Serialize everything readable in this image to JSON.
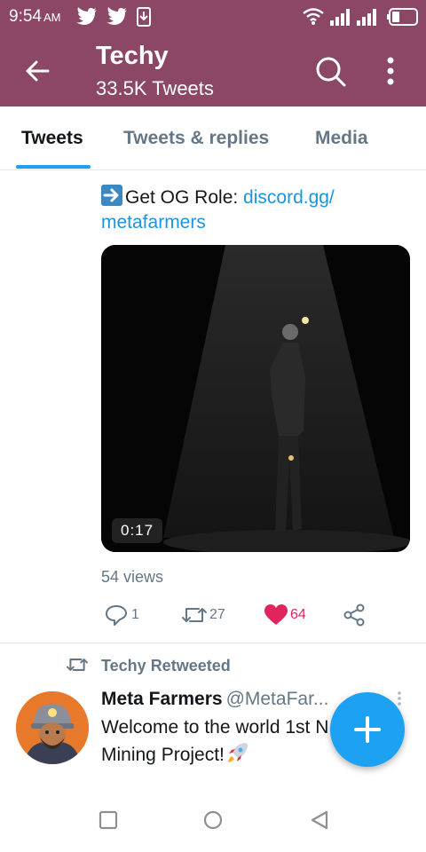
{
  "status_bar": {
    "time": "9:54",
    "ampm": "AM"
  },
  "header": {
    "title": "Techy",
    "subtitle": "33.5K Tweets",
    "back_icon": "arrow-left-icon",
    "search_icon": "search-icon",
    "more_icon": "more-vertical-icon",
    "background_color": "#8c4766"
  },
  "tabs": [
    {
      "label": "Tweets",
      "active": true
    },
    {
      "label": "Tweets & replies",
      "active": false
    },
    {
      "label": "Media",
      "active": false
    }
  ],
  "tweet": {
    "text_prefix": "Get OG Role: ",
    "link_line1": "discord.gg/",
    "link_line2": "metafarmers",
    "video_duration": "0:17",
    "views": "54 views",
    "reply_count": "1",
    "retweet_count": "27",
    "like_count": "64",
    "liked": true,
    "like_color": "#e0245e",
    "link_color": "#1b95e0"
  },
  "retweet": {
    "label": "Techy Retweeted",
    "author_name": "Meta Farmers",
    "author_handle": "@MetaFar...",
    "text_line1": "Welcome to the world 1st N",
    "text_line2": "Mining Project!"
  },
  "fab": {
    "icon": "plus-icon",
    "color": "#1da1f2"
  },
  "nav_bar": {
    "icons": [
      "recents-square-icon",
      "home-circle-icon",
      "back-triangle-icon"
    ]
  }
}
